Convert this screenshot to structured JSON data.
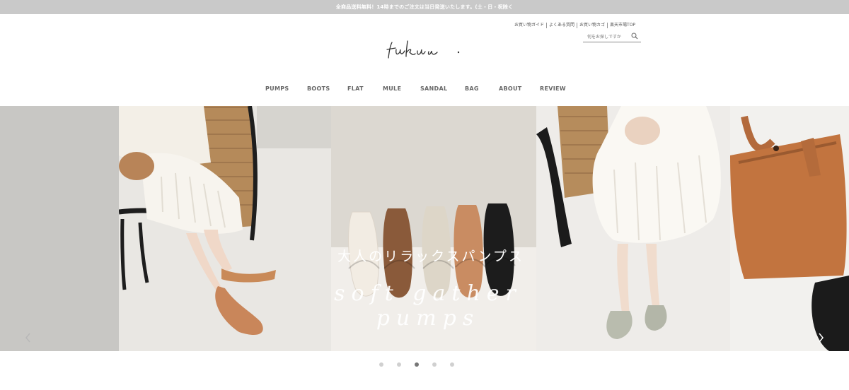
{
  "announcement": "全商品送料無料！14時までのご注文は当日発送いたします。(土・日・祝除く",
  "util_links": [
    "お買い物ガイド",
    "よくある質問",
    "お買い物カゴ",
    "楽天市場TOP"
  ],
  "search": {
    "placeholder": "何をお探しですか",
    "icon": "search-icon"
  },
  "logo_text": "fuku.",
  "nav": [
    "PUMPS",
    "BOOTS",
    "FLAT",
    "MULE",
    "SANDAL",
    "BAG",
    "ABOUT",
    "REVIEW"
  ],
  "hero": {
    "title_jp": "大人のリラックスパンプス",
    "title_en": "soft gather pumps"
  },
  "slider": {
    "slide_count": 5,
    "active_index": 2,
    "prev_icon": "chevron-left-icon",
    "next_icon": "chevron-right-icon"
  },
  "colors": {
    "announce_bg": "#c9c9c9",
    "nav_text": "#666666",
    "dot_active": "#777777",
    "dot_inactive": "#d0d0d0"
  }
}
